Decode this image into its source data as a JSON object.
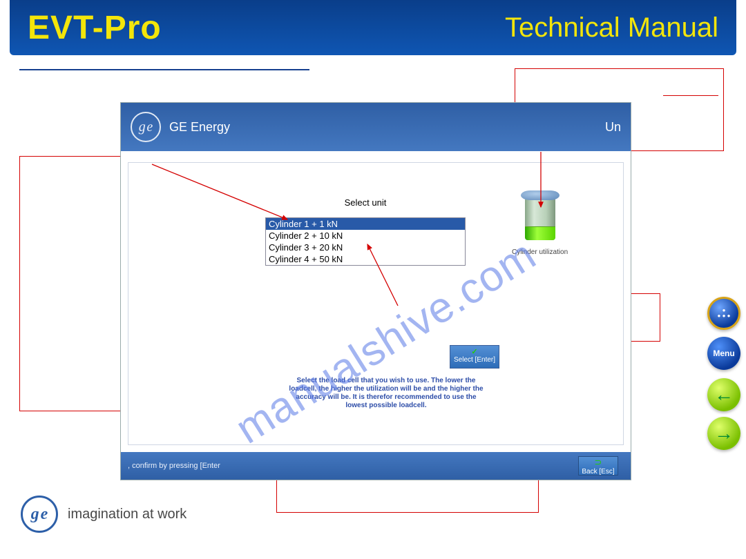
{
  "banner": {
    "title": "EVT-Pro",
    "subtitle": "Technical Manual"
  },
  "watermark": "manualshive.com",
  "app": {
    "brand": "GE Energy",
    "header_right_partial": "Un",
    "select_unit_title": "Select unit",
    "options": [
      "Cylinder 1 + 1 kN",
      "Cylinder 2 + 10 kN",
      "Cylinder 3 + 20 kN",
      "Cylinder 4 + 50 kN"
    ],
    "selected_index": 0,
    "util_label": "Cylinder utilization",
    "select_btn": "Select [Enter]",
    "back_btn": "Back [Esc]",
    "help_text": "Select the load cell that you wish to use. The lower the loadcell, the higher the utilization will be and the higher the accuracy will be. It is therefor recommended to use the lowest possible loadcell.",
    "footer_hint": ", confirm by pressing [Enter"
  },
  "footer": {
    "slogan": "imagination at work"
  },
  "nav": {
    "menu": "Menu"
  }
}
